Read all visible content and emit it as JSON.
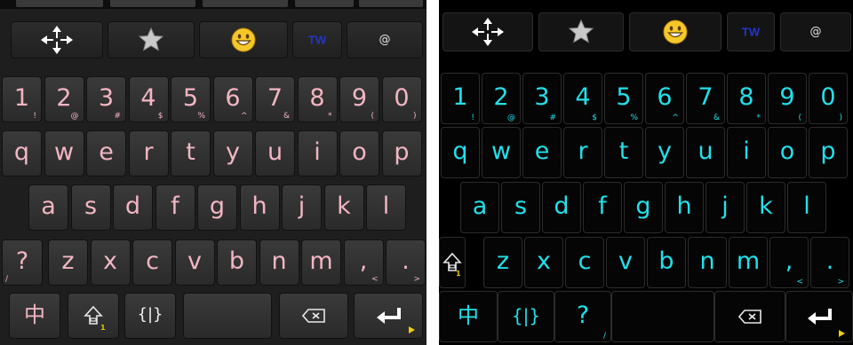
{
  "toolbar": {
    "tw_label": "TW",
    "at_label": "@"
  },
  "number_row": [
    {
      "main": "1",
      "sub": "!"
    },
    {
      "main": "2",
      "sub": "@"
    },
    {
      "main": "3",
      "sub": "#"
    },
    {
      "main": "4",
      "sub": "$"
    },
    {
      "main": "5",
      "sub": "%"
    },
    {
      "main": "6",
      "sub": "^"
    },
    {
      "main": "7",
      "sub": "&"
    },
    {
      "main": "8",
      "sub": "*"
    },
    {
      "main": "9",
      "sub": "("
    },
    {
      "main": "0",
      "sub": ")"
    }
  ],
  "row_qwerty": [
    "q",
    "w",
    "e",
    "r",
    "t",
    "y",
    "u",
    "i",
    "o",
    "p"
  ],
  "row_home": [
    "a",
    "s",
    "d",
    "f",
    "g",
    "h",
    "j",
    "k",
    "l"
  ],
  "row_bottom": [
    {
      "main": "z",
      "sub": ""
    },
    {
      "main": "x",
      "sub": ""
    },
    {
      "main": "c",
      "sub": ""
    },
    {
      "main": "v",
      "sub": ""
    },
    {
      "main": "b",
      "sub": ""
    },
    {
      "main": "n",
      "sub": ""
    },
    {
      "main": "m",
      "sub": ""
    },
    {
      "main": ",",
      "sub": "<"
    },
    {
      "main": ".",
      "sub": ">"
    }
  ],
  "question_key": {
    "main": "?",
    "sub": "/"
  },
  "chinese_label": "中",
  "braces_label": "{|}",
  "shift_badge": "1",
  "icons": {
    "move": "move-arrows-icon",
    "favorite": "star-icon",
    "emoji": "smiley-icon",
    "shift": "shift-arrow-icon",
    "backspace": "backspace-icon",
    "enter": "enter-icon"
  },
  "colors": {
    "left_key_text": "#f2b6c2",
    "right_key_text": "#22e0ea",
    "left_background": "#1e1e1e",
    "right_background": "#000000",
    "tw_color": "#2236c8",
    "accent_yellow": "#f0d000"
  }
}
